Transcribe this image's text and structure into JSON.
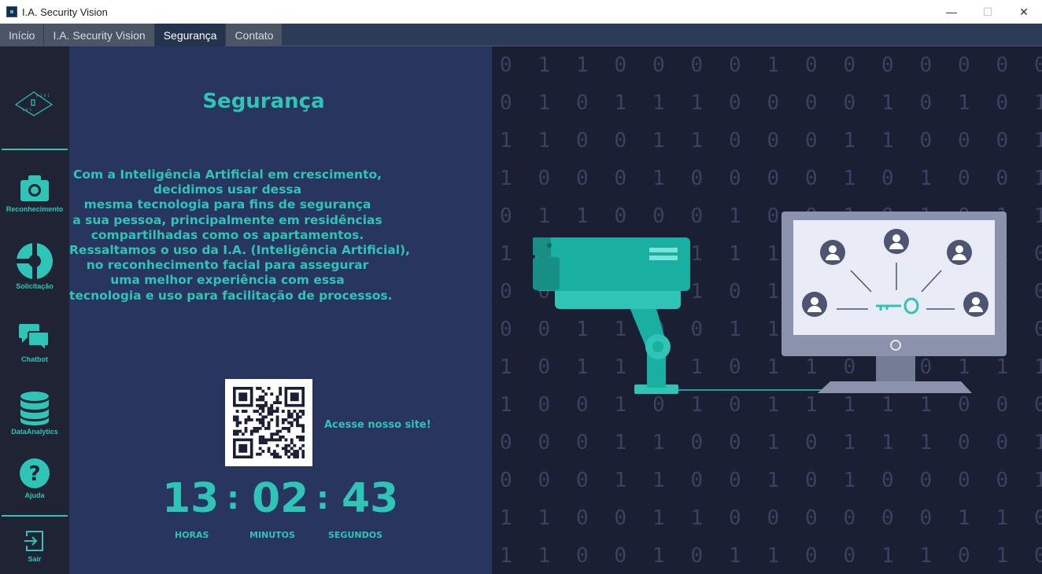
{
  "window": {
    "title": "I.A. Security Vision",
    "minimize_glyph": "—",
    "maximize_glyph": "☐",
    "close_glyph": "✕"
  },
  "tabs": [
    {
      "label": "Início",
      "active": false
    },
    {
      "label": "I.A. Security Vision",
      "active": false
    },
    {
      "label": "Segurança",
      "active": true
    },
    {
      "label": "Contato",
      "active": false
    }
  ],
  "sidebar": {
    "items": [
      {
        "label": "Reconhecimento",
        "icon": "camera-icon"
      },
      {
        "label": "Solicitação",
        "icon": "pie-chart-icon"
      },
      {
        "label": "Chatbot",
        "icon": "chat-bubbles-icon"
      },
      {
        "label": "DataAnalytics",
        "icon": "database-icon"
      },
      {
        "label": "Ajuda",
        "icon": "help-icon"
      },
      {
        "label": "Sair",
        "icon": "exit-icon"
      }
    ]
  },
  "main": {
    "heading": "Segurança",
    "paragraph_lines": [
      "Com a Inteligência Artificial em crescimento,",
      "decidimos usar dessa",
      "mesma tecnologia para fins de segurança",
      "a sua pessoa, principalmente em residências",
      "compartilhadas como os apartamentos.",
      "Ressaltamos o uso da I.A. (Inteligência Artificial),",
      "no reconhecimento facial para assegurar",
      "uma melhor experiência com essa",
      "tecnologia e uso para facilitação de processos."
    ],
    "qr_caption": "Acesse nosso site!"
  },
  "clock": {
    "hours": "13",
    "minutes": "02",
    "seconds": "43",
    "separator": ":",
    "hours_label": "HORAS",
    "minutes_label": "MINUTOS",
    "seconds_label": "SEGUNDOS"
  },
  "colors": {
    "accent": "#2ec4b6",
    "panel": "#27355f",
    "sidebar": "#1f2334",
    "background": "#1b1f33"
  }
}
